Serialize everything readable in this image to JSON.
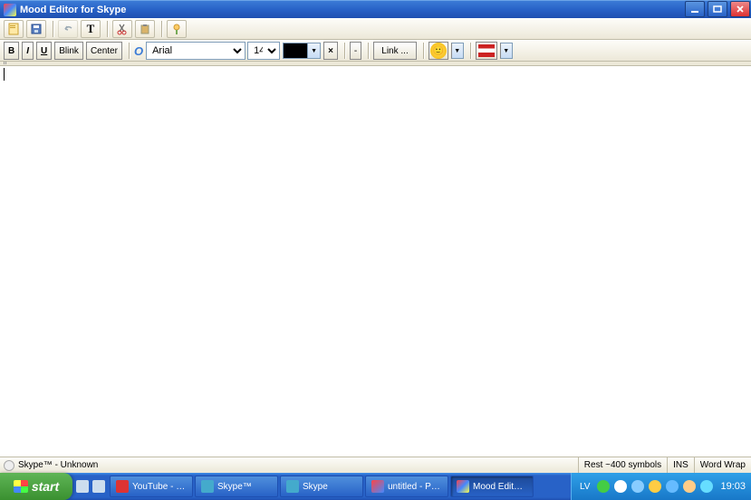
{
  "title": "Mood Editor for Skype",
  "toolbar1": {
    "new_hint": "new",
    "save_hint": "save",
    "undo_hint": "undo",
    "text_hint": "T",
    "cut_hint": "cut",
    "paste_hint": "paste",
    "mode_hint": "mode"
  },
  "format": {
    "bold": "B",
    "italic": "I",
    "underline": "U",
    "blink": "Blink",
    "center": "Center",
    "font_name": "Arial",
    "font_size": "14",
    "clear": "×",
    "dash": "-",
    "link": "Link ..."
  },
  "status": {
    "left": "Skype™ - Unknown",
    "rest": "Rest ~400 symbols",
    "ins": "INS",
    "wrap": "Word Wrap"
  },
  "taskbar": {
    "start": "start",
    "items": [
      {
        "label": "YouTube - Broadcast ..."
      },
      {
        "label": "Skype™"
      },
      {
        "label": "Skype"
      },
      {
        "label": "untitled - Paint"
      },
      {
        "label": "Mood Editor for Skype"
      }
    ],
    "lang": "LV",
    "clock": "19:03"
  }
}
